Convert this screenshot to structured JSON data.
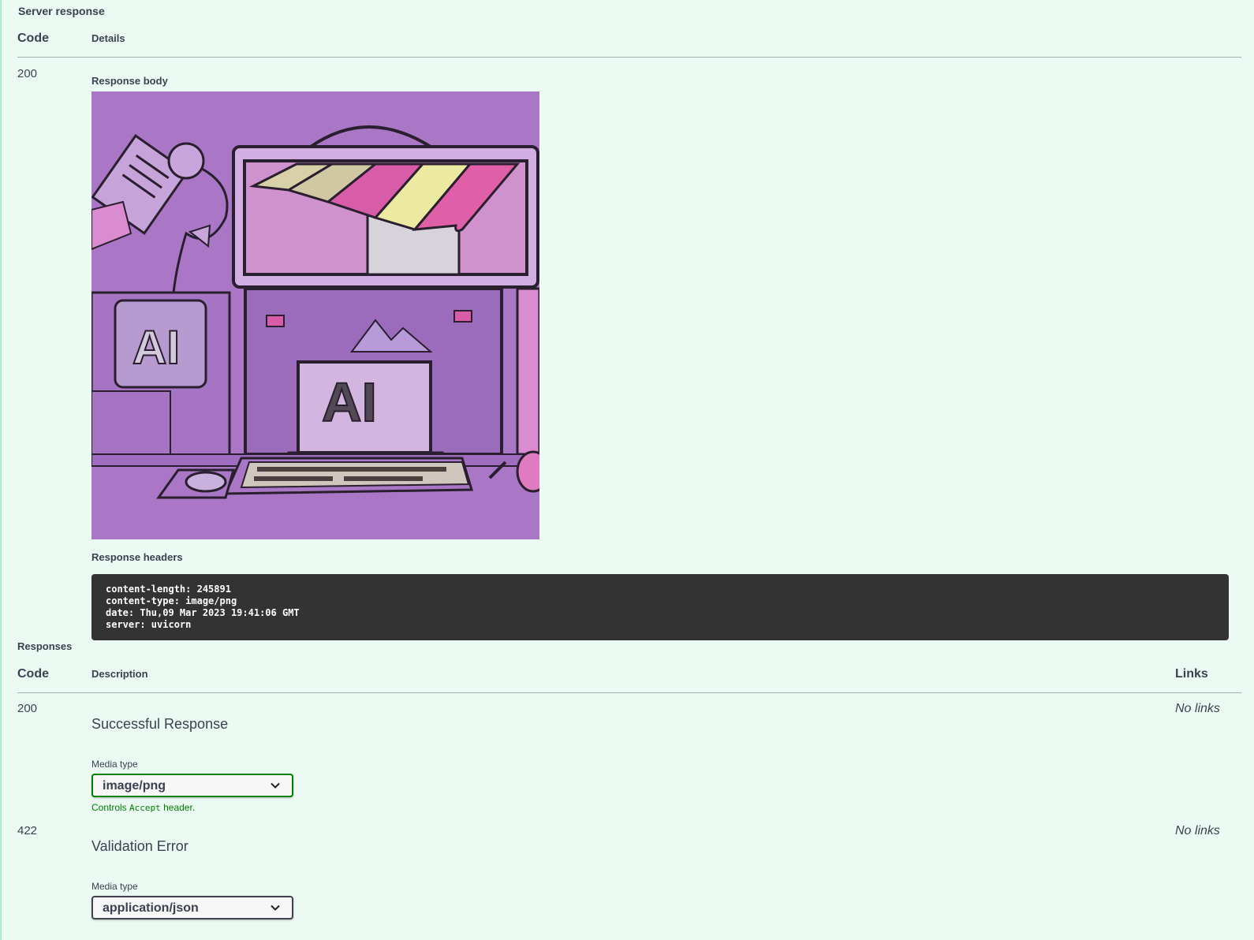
{
  "server_response": {
    "title": "Server response",
    "code_header": "Code",
    "details_header": "Details",
    "code": "200",
    "response_body_label": "Response body",
    "response_image": {
      "logo_text_1": "AI",
      "logo_text_2": "AI",
      "colors": {
        "background": "#a977c6",
        "pink": "#d95ca8",
        "yellow": "#ece9a0",
        "khaki": "#cfc8a3"
      }
    },
    "response_headers_label": "Response headers",
    "headers": [
      "content-length: 245891",
      "content-type: image/png",
      "date: Thu,09 Mar 2023 19:41:06 GMT",
      "server: uvicorn"
    ]
  },
  "responses": {
    "title": "Responses",
    "code_header": "Code",
    "description_header": "Description",
    "links_header": "Links",
    "items": [
      {
        "code": "200",
        "description": "Successful Response",
        "media_type_label": "Media type",
        "media_type": "image/png",
        "controls_prefix": "Controls ",
        "controls_code": "Accept",
        "controls_suffix": " header.",
        "links": "No links"
      },
      {
        "code": "422",
        "description": "Validation Error",
        "media_type_label": "Media type",
        "media_type": "application/json",
        "links": "No links"
      }
    ]
  },
  "colors": {
    "page_bg": "#ebfaf3",
    "accent_green": "#008000",
    "headers_bg": "#333333"
  },
  "icons": {
    "select_arrow": "chevron-down-icon"
  }
}
